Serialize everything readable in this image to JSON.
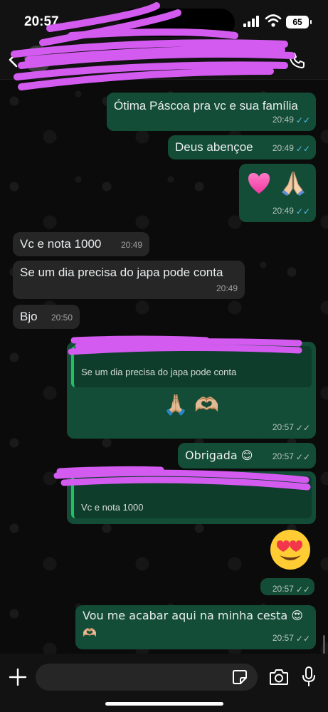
{
  "status_bar": {
    "time": "20:57",
    "battery": "65"
  },
  "header": {
    "contact_name": "",
    "last_seen": ""
  },
  "messages": [
    {
      "dir": "out",
      "text": "Ótima Páscoa pra vc e sua família",
      "time": "20:49",
      "status": "read"
    },
    {
      "dir": "out",
      "text": "Deus abençoe",
      "time": "20:49",
      "status": "read"
    },
    {
      "dir": "out",
      "text": "",
      "time": "20:49",
      "status": "read",
      "emoji": [
        "pink-heart",
        "folded-hands"
      ]
    },
    {
      "dir": "in",
      "text": "Vc e nota 1000",
      "time": "20:49"
    },
    {
      "dir": "in",
      "text": "Se um dia precisa do japa pode conta",
      "time": "20:49"
    },
    {
      "dir": "in",
      "text": "Bjo",
      "time": "20:50"
    },
    {
      "dir": "out",
      "text": "🙏🏼 🫶🏼",
      "time": "20:57",
      "status": "sent",
      "quote_text": "Se um dia precisa do japa pode conta"
    },
    {
      "dir": "out",
      "text": "Obrigada 😊",
      "time": "20:57",
      "status": "sent"
    },
    {
      "dir": "out",
      "text": "",
      "time": "",
      "status": "",
      "quote_text": "Vc e nota 1000"
    },
    {
      "dir": "out",
      "text": "😍",
      "time": "20:57",
      "status": "sent"
    },
    {
      "dir": "out",
      "text": "Vou me acabar aqui na minha cesta 😍",
      "text2": "🫶🏼",
      "time": "20:57",
      "status": "sent"
    }
  ],
  "composer": {
    "placeholder": ""
  },
  "colors": {
    "outgoing_bubble": "#144d37",
    "incoming_bubble": "#262626",
    "read_ticks": "#53bdeb",
    "redaction": "#d35bf0"
  },
  "icons": [
    "back-icon",
    "phone-icon",
    "plus-icon",
    "sticker-icon",
    "camera-icon",
    "mic-icon",
    "wifi-icon",
    "signal-icon"
  ]
}
